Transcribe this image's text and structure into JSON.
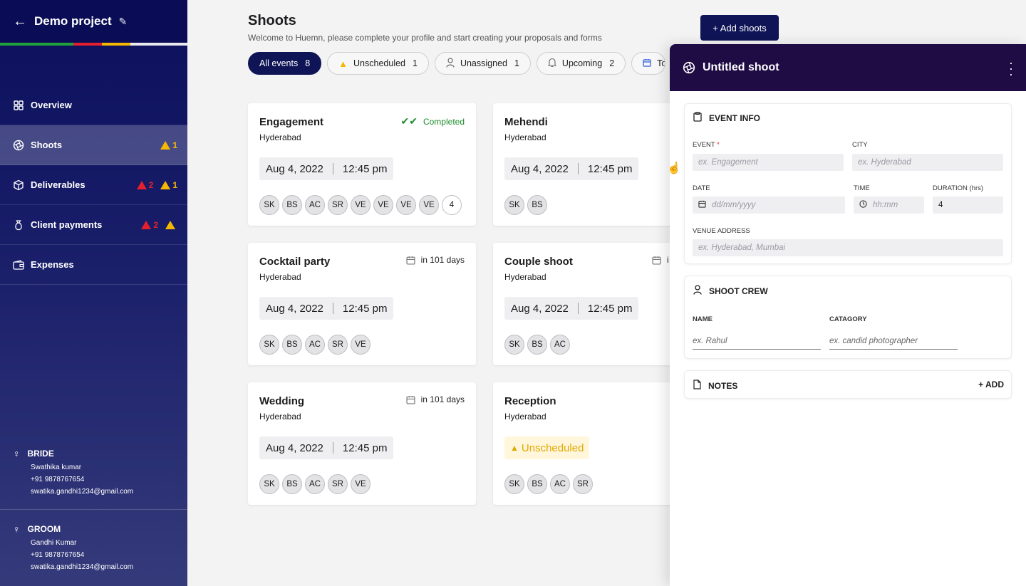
{
  "project": {
    "title": "Demo project",
    "back_icon": "arrow-left-icon",
    "edit_icon": "pencil-icon"
  },
  "stripe_colors": [
    "#1fa33a",
    "#e5202e",
    "#f5b800",
    "#ffffff"
  ],
  "nav": [
    {
      "label": "Overview",
      "icon": "grid-icon",
      "active": false
    },
    {
      "label": "Shoots",
      "icon": "aperture-icon",
      "active": true,
      "warn": "1"
    },
    {
      "label": "Deliverables",
      "icon": "box-icon",
      "active": false,
      "error": "2",
      "warn": "1"
    },
    {
      "label": "Client payments",
      "icon": "money-bag-icon",
      "active": false,
      "error": "2",
      "warn": ""
    },
    {
      "label": "Expenses",
      "icon": "wallet-icon",
      "active": false
    }
  ],
  "bride": {
    "role": "BRIDE",
    "name": "Swathika kumar",
    "phone": "+91 9878767654",
    "email": "swatika.gandhi1234@gmail.com"
  },
  "groom": {
    "role": "GROOM",
    "name": "Gandhi Kumar",
    "phone": "+91 9878767654",
    "email": "swatika.gandhi1234@gmail.com"
  },
  "header": {
    "title": "Shoots",
    "subtitle": "Welcome to Huemn, please complete your profile and start creating your proposals and forms",
    "add_button": "+ Add shoots"
  },
  "filters": [
    {
      "label": "All events",
      "count": "8"
    },
    {
      "label": "Unscheduled",
      "count": "1"
    },
    {
      "label": "Unassigned",
      "count": "1"
    },
    {
      "label": "Upcoming",
      "count": "2"
    },
    {
      "label": "To",
      "count": ""
    }
  ],
  "cards": [
    {
      "name": "Engagement",
      "city": "Hyderabad",
      "status": "Completed",
      "date": "Aug 4, 2022",
      "time": "12:45 pm",
      "crew": [
        "SK",
        "BS",
        "AC",
        "SR",
        "VE",
        "VE",
        "VE",
        "VE"
      ],
      "more": "4"
    },
    {
      "name": "Mehendi",
      "city": "Hyderabad",
      "status": "",
      "date": "Aug 4, 2022",
      "time": "12:45 pm",
      "crew": [
        "SK",
        "BS"
      ]
    },
    {
      "name": "Cocktail party",
      "city": "Hyderabad",
      "status": "in 101 days",
      "date": "Aug 4, 2022",
      "time": "12:45 pm",
      "crew": [
        "SK",
        "BS",
        "AC",
        "SR",
        "VE"
      ]
    },
    {
      "name": "Couple shoot",
      "city": "Hyderabad",
      "status": "i",
      "date": "Aug 4, 2022",
      "time": "12:45 pm",
      "crew": [
        "SK",
        "BS",
        "AC"
      ]
    },
    {
      "name": "Wedding",
      "city": "Hyderabad",
      "status": "in 101 days",
      "date": "Aug 4, 2022",
      "time": "12:45 pm",
      "crew": [
        "SK",
        "BS",
        "AC",
        "SR",
        "VE"
      ]
    },
    {
      "name": "Reception",
      "city": "Hyderabad",
      "status": "",
      "unscheduled": "Unscheduled",
      "crew": [
        "SK",
        "BS",
        "AC",
        "SR"
      ]
    }
  ],
  "drawer": {
    "title": "Untitled shoot",
    "event_info": {
      "heading": "EVENT INFO",
      "event_label": "EVENT",
      "event_required": "*",
      "event_placeholder": "ex. Engagement",
      "city_label": "CITY",
      "city_placeholder": "ex. Hyderabad",
      "date_label": "DATE",
      "date_placeholder": "dd/mm/yyyy",
      "time_label": "TIME",
      "time_placeholder": "hh:mm",
      "duration_label": "DURATION (hrs)",
      "duration_value": "4",
      "venue_label": "VENUE ADDRESS",
      "venue_placeholder": "ex. Hyderabad, Mumbai"
    },
    "crew": {
      "heading": "SHOOT CREW",
      "name_label": "NAME",
      "name_placeholder": "ex. Rahul",
      "category_label": "CATAGORY",
      "category_placeholder": "ex. candid photographer"
    },
    "notes": {
      "heading": "NOTES",
      "add": "+ ADD"
    }
  }
}
